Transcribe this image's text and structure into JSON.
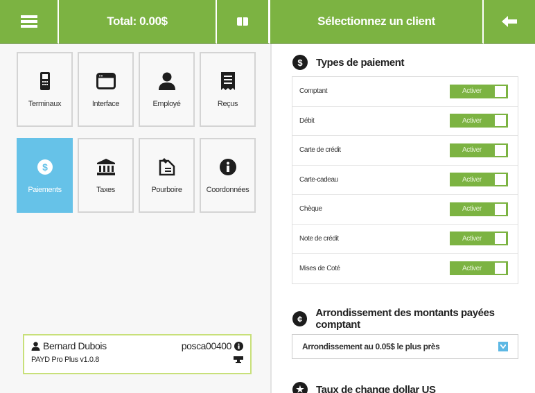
{
  "topbar": {
    "menu_icon": "hamburger-menu-icon",
    "total": "Total: 0.00$",
    "drawer_icon": "cash-drawer-icon",
    "client": "Sélectionnez un client",
    "back_icon": "arrow-left-icon"
  },
  "tiles": [
    {
      "label": "Terminaux",
      "icon": "payment-terminal-icon"
    },
    {
      "label": "Interface",
      "icon": "window-icon"
    },
    {
      "label": "Employé",
      "icon": "user-icon"
    },
    {
      "label": "Reçus",
      "icon": "receipt-icon"
    },
    {
      "label": "Paiements",
      "icon": "dollar-circle-icon",
      "active": true
    },
    {
      "label": "Taxes",
      "icon": "bank-icon"
    },
    {
      "label": "Pourboire",
      "icon": "tip-icon"
    },
    {
      "label": "Coordonnées",
      "icon": "info-icon"
    }
  ],
  "user": {
    "name": "Bernard Dubois",
    "code": "posca00400",
    "version": "PAYD Pro Plus v1.0.8"
  },
  "payments": {
    "title": "Types de paiement",
    "toggle_label": "Activer",
    "rows": [
      "Comptant",
      "Débit",
      "Carte de crédit",
      "Carte-cadeau",
      "Chèque",
      "Note de crédit",
      "Mises de Coté"
    ]
  },
  "rounding": {
    "title": "Arrondissement des montants payées comptant",
    "selected": "Arrondissement au 0.05$ le plus près"
  },
  "exchange": {
    "title": "Taux de change dollar US"
  },
  "colors": {
    "accent_green": "#7cb342",
    "active_blue": "#66c2e8"
  }
}
